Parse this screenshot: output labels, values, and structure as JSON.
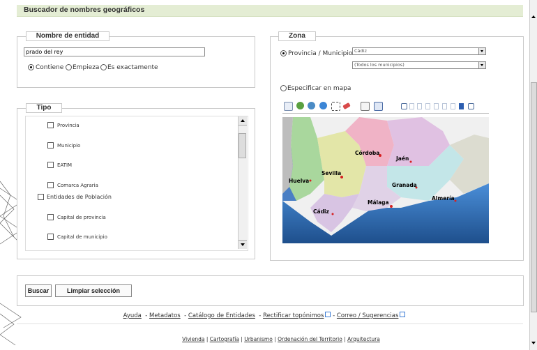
{
  "header": {
    "title": "Buscador de nombres geográficos"
  },
  "nombre": {
    "legend": "Nombre de entidad",
    "value": "prado del rey",
    "options": [
      "Contiene",
      "Empieza",
      "Es exactamente"
    ],
    "selected": "Contiene"
  },
  "tipo": {
    "legend": "Tipo",
    "items": [
      "Provincia",
      "Municipio",
      "EATIM",
      "Comarca Agraria",
      "Entidades de Población",
      "Capital de provincia",
      "Capital de municipio"
    ]
  },
  "zona": {
    "legend": "Zona",
    "option1": "Provincia / Municipio",
    "province_value": "Cádiz",
    "municipio_value": "(Todos los municipios)",
    "option2": "Especificar en mapa",
    "cities": [
      "Córdoba",
      "Jaén",
      "Sevilla",
      "Huelva",
      "Granada",
      "Almería",
      "Málaga",
      "Cádiz"
    ]
  },
  "buttons": {
    "search": "Buscar",
    "clear": "Limpiar selección"
  },
  "links": {
    "row1": [
      "Ayuda",
      "Metadatos",
      "Catálogo de Entidades",
      "Rectificar topónimos",
      "Correo / Sugerencias"
    ],
    "row2": [
      "Vivienda",
      "Cartografía",
      "Urbanismo",
      "Ordenación del Territorio",
      "Arquitectura"
    ]
  },
  "colors": {
    "title_bar": "#e4edd4",
    "border": "#c8c8c8"
  }
}
